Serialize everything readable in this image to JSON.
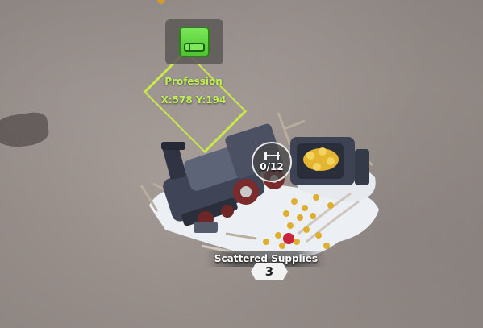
{
  "marker": {
    "icon": "book-icon",
    "title": "Profession",
    "coords": "X:578 Y:194",
    "color": "#bff05a"
  },
  "site": {
    "task_progress": "0/12",
    "task_icon": "barbell-icon",
    "name": "Scattered Supplies",
    "level": "3"
  }
}
